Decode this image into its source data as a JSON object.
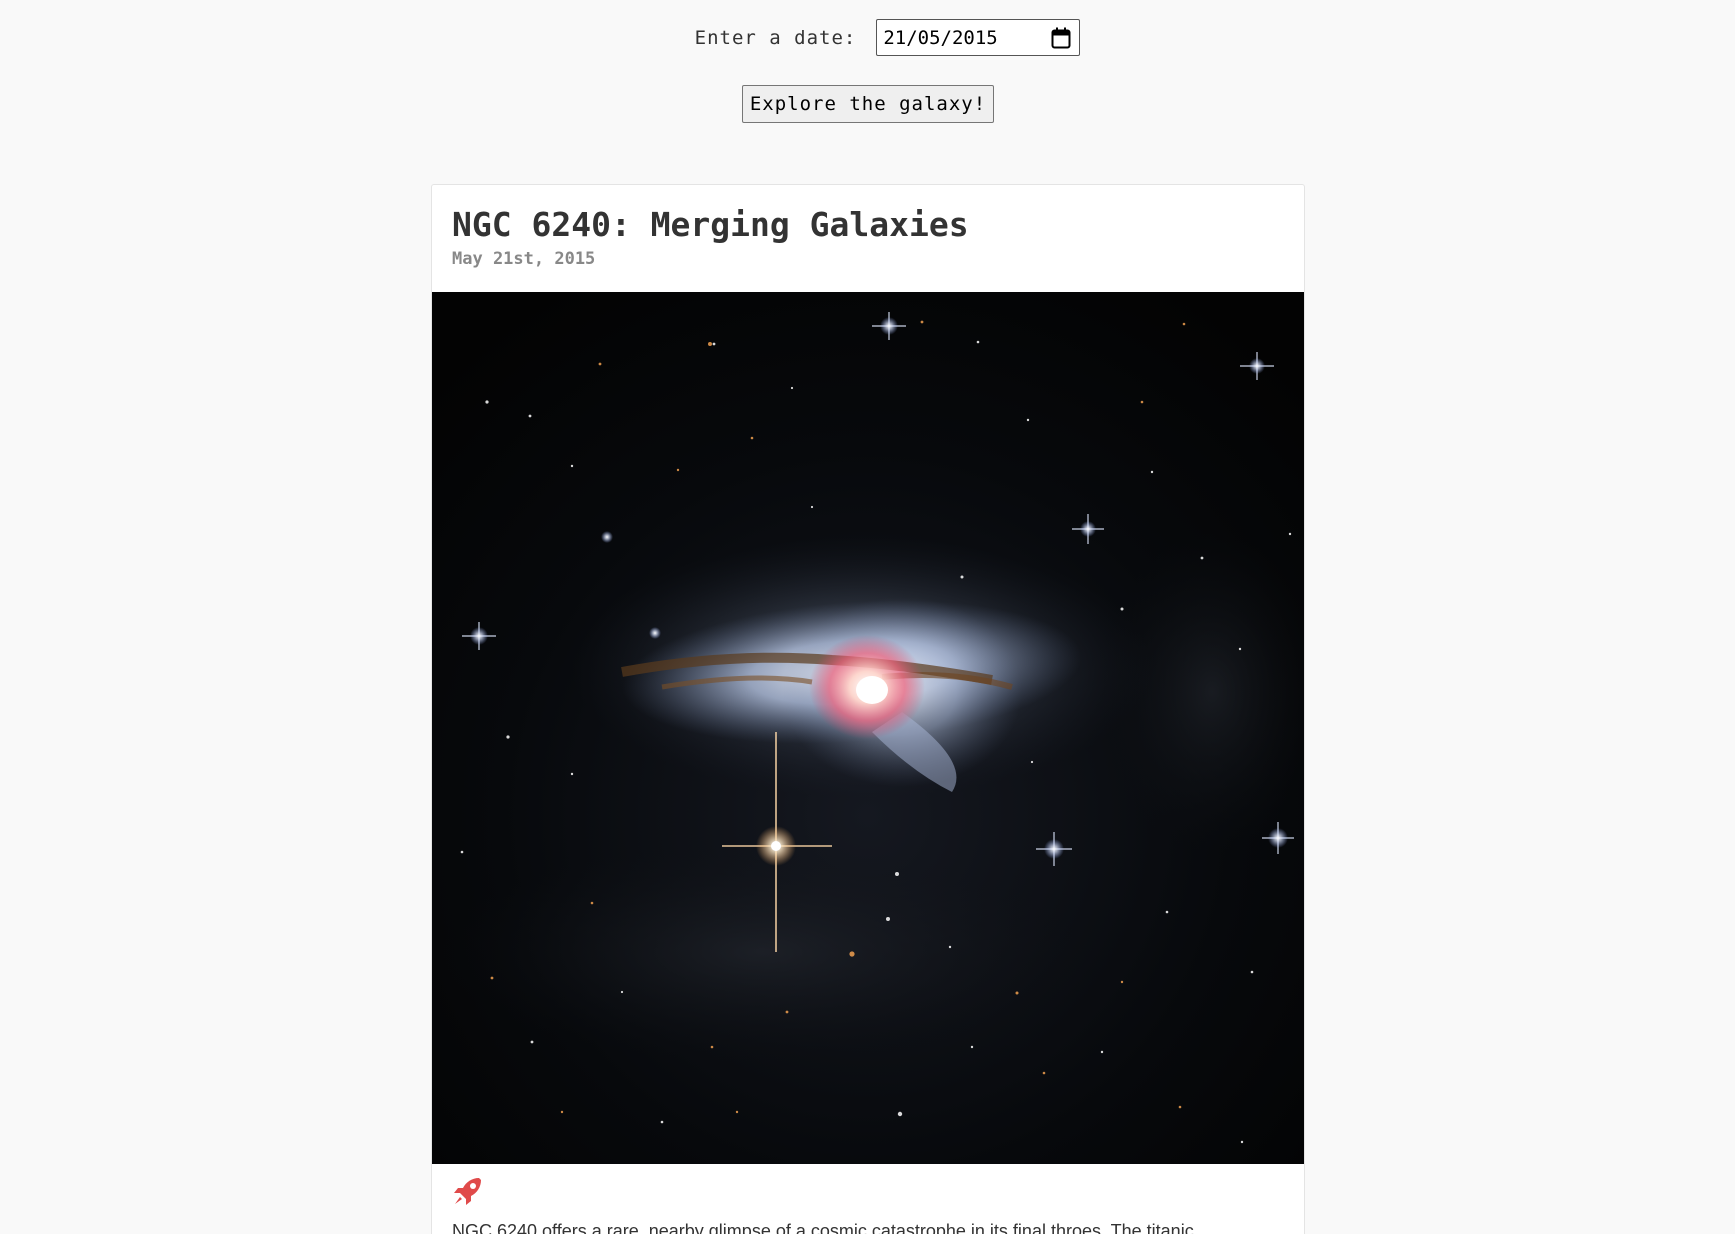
{
  "date_form": {
    "label": "Enter a date:",
    "value": "21/05/2015",
    "button_label": "Explore the galaxy!"
  },
  "apod": {
    "title": "NGC 6240: Merging Galaxies",
    "date": "May 21st, 2015",
    "image_alt": "Merging galaxies NGC 6240 against a dark starfield",
    "media_icon": "rocket-icon",
    "explanation": "NGC 6240 offers a rare, nearby glimpse of a cosmic catastrophe in its final throes. The titanic"
  },
  "colors": {
    "background": "#f9f9f9",
    "card": "#ffffff",
    "title": "#333333",
    "date": "#888888",
    "accent": "#e04a4a"
  }
}
